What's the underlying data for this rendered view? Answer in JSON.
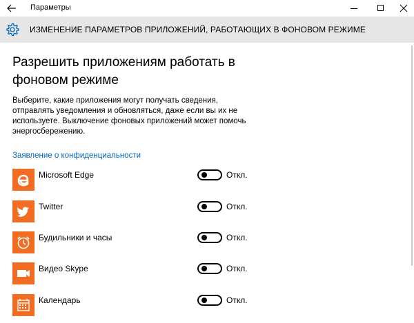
{
  "window": {
    "title": "Параметры"
  },
  "header": {
    "title": "ИЗМЕНЕНИЕ ПАРАМЕТРОВ ПРИЛОЖЕНИЙ, РАБОТАЮЩИХ В ФОНОВОМ РЕЖИМЕ"
  },
  "main": {
    "title": "Разрешить приложениям работать в фоновом режиме",
    "description": "Выберите, какие приложения могут получать сведения, отправлять уведомления и обновляться, даже если вы их не используете. Выключение фоновых приложений может помочь энергосбережению.",
    "privacy_link": "Заявление о конфиденциальности"
  },
  "colors": {
    "accent": "#f26d21",
    "link": "#0067b8",
    "header_bg": "#e6e6e6"
  },
  "apps": [
    {
      "name": "Microsoft Edge",
      "icon": "edge-icon",
      "state": "Откл."
    },
    {
      "name": "Twitter",
      "icon": "twitter-bird-icon",
      "state": "Откл."
    },
    {
      "name": "Будильники и часы",
      "icon": "alarm-clock-icon",
      "state": "Откл."
    },
    {
      "name": "Видео Skype",
      "icon": "video-camera-icon",
      "state": "Откл."
    },
    {
      "name": "Календарь",
      "icon": "calendar-icon",
      "state": "Откл."
    }
  ]
}
